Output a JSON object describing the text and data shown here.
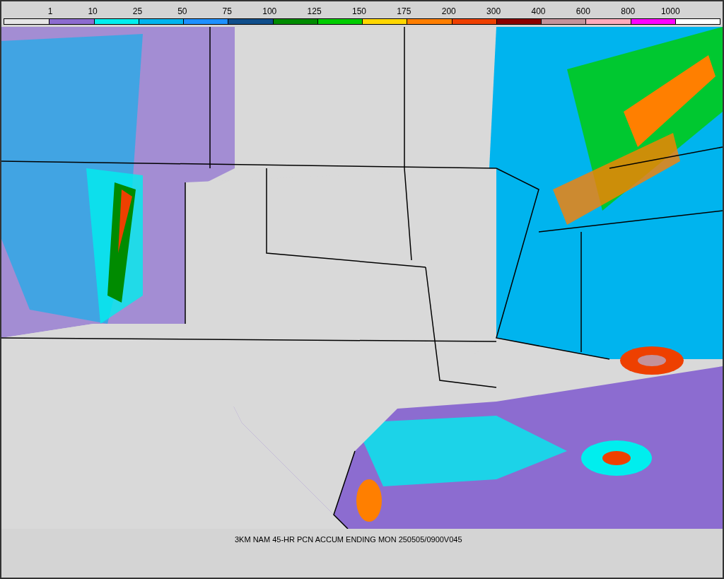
{
  "legend": {
    "labels": [
      "1",
      "10",
      "25",
      "50",
      "75",
      "100",
      "125",
      "150",
      "175",
      "200",
      "300",
      "400",
      "600",
      "800",
      "1000"
    ],
    "swatches": [
      {
        "color": "#e6e6e6"
      },
      {
        "color": "#8c6cd0"
      },
      {
        "color": "#00eeee"
      },
      {
        "color": "#00b4ee"
      },
      {
        "color": "#1e90ff"
      },
      {
        "color": "#104e8b"
      },
      {
        "color": "#008b00"
      },
      {
        "color": "#00cd00"
      },
      {
        "color": "#ffd700"
      },
      {
        "color": "#ff7f00"
      },
      {
        "color": "#ee4000"
      },
      {
        "color": "#8b0000"
      },
      {
        "color": "#c4929a"
      },
      {
        "color": "#ffaabb"
      },
      {
        "color": "#ff00ff"
      },
      {
        "color": "#ffffff"
      }
    ]
  },
  "caption": "3KM NAM 45-HR PCN ACCUM ENDING MON 250505/0900V045"
}
